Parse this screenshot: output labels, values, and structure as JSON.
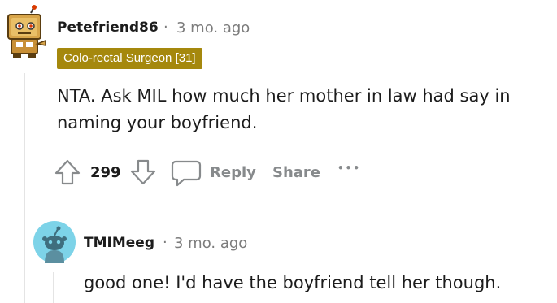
{
  "comment": {
    "username": "Petefriend86",
    "separator": "·",
    "time": "3 mo. ago",
    "flair": "Colo-rectal Surgeon [31]",
    "body_line1": "NTA. Ask MIL how much her mother in law had say in",
    "body_line2": "naming your boyfriend.",
    "votes": "299",
    "reply_label": "Reply",
    "share_label": "Share",
    "more_label": "•••"
  },
  "reply": {
    "username": "TMIMeeg",
    "separator": "·",
    "time": "3 mo. ago",
    "body": "good one! I'd have the boyfriend tell her though."
  },
  "colors": {
    "flair_bg": "#a5880d",
    "avatar2_bg": "#7dd3e8",
    "muted": "#878a8c"
  },
  "icons": {
    "upvote": "arrow-up-icon",
    "downvote": "arrow-down-icon",
    "reply": "comment-bubble-icon",
    "more": "more-horizontal-icon"
  }
}
